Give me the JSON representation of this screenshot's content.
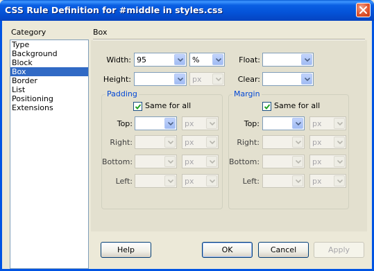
{
  "window": {
    "title": "CSS Rule Definition for #middle in styles.css"
  },
  "category": {
    "label": "Category",
    "items": [
      "Type",
      "Background",
      "Block",
      "Box",
      "Border",
      "List",
      "Positioning",
      "Extensions"
    ],
    "selected": "Box"
  },
  "section_title": "Box",
  "box": {
    "width_label": "Width:",
    "width_value": "95",
    "width_unit": "%",
    "height_label": "Height:",
    "height_value": "",
    "height_unit": "px",
    "float_label": "Float:",
    "float_value": "",
    "clear_label": "Clear:",
    "clear_value": ""
  },
  "padding": {
    "title": "Padding",
    "same_for_all": "Same for all",
    "same_checked": true,
    "top_label": "Top:",
    "right_label": "Right:",
    "bottom_label": "Bottom:",
    "left_label": "Left:",
    "unit": "px"
  },
  "margin": {
    "title": "Margin",
    "same_for_all": "Same for all",
    "same_checked": true,
    "top_label": "Top:",
    "right_label": "Right:",
    "bottom_label": "Bottom:",
    "left_label": "Left:",
    "unit": "px"
  },
  "buttons": {
    "help": "Help",
    "ok": "OK",
    "cancel": "Cancel",
    "apply": "Apply"
  },
  "colors": {
    "title_bar": "#0054e3",
    "selection": "#316ac5",
    "group_label": "#0046d5"
  }
}
